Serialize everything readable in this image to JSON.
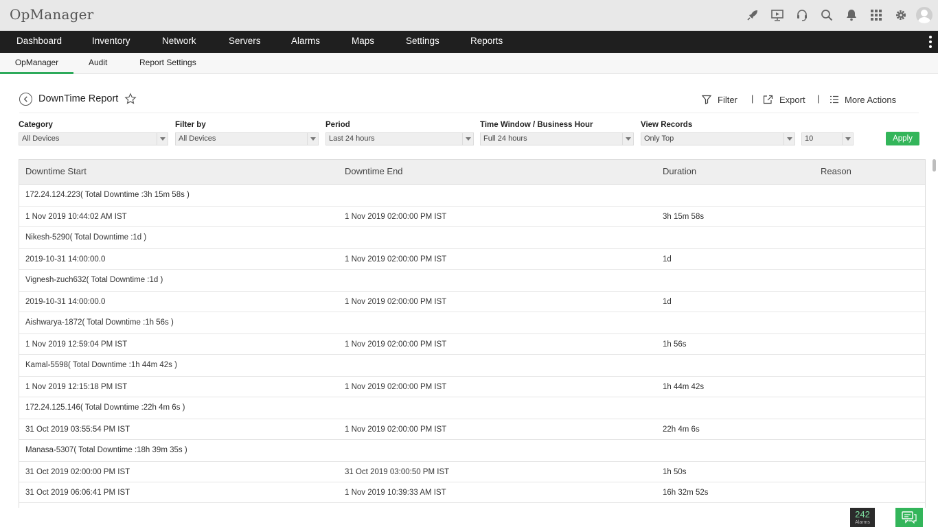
{
  "app": {
    "brand": "OpManager"
  },
  "topbar": {
    "icons": [
      "rocket-icon",
      "presentation-icon",
      "headset-icon",
      "search-icon",
      "bell-icon",
      "apps-grid-icon",
      "gear-icon",
      "user-avatar-icon"
    ]
  },
  "mainnav": {
    "items": [
      "Dashboard",
      "Inventory",
      "Network",
      "Servers",
      "Alarms",
      "Maps",
      "Settings",
      "Reports"
    ]
  },
  "subnav": {
    "items": [
      "OpManager",
      "Audit",
      "Report Settings"
    ],
    "active": "OpManager"
  },
  "report": {
    "title": "DownTime Report",
    "filter_label": "Filter",
    "export_label": "Export",
    "more_label": "More Actions",
    "separator": "|"
  },
  "filters": {
    "category": {
      "label": "Category",
      "value": "All Devices"
    },
    "filter_by": {
      "label": "Filter by",
      "value": "All Devices"
    },
    "period": {
      "label": "Period",
      "value": "Last 24 hours"
    },
    "time_window": {
      "label": "Time Window / Business Hour",
      "value": "Full 24 hours"
    },
    "view_records": {
      "label": "View Records",
      "value": "Only Top"
    },
    "count": {
      "value": "10"
    },
    "apply_label": "Apply"
  },
  "table": {
    "columns": [
      "Downtime Start",
      "Downtime End",
      "Duration",
      "Reason"
    ],
    "rows": [
      {
        "type": "group",
        "text": "172.24.124.223( Total Downtime :3h 15m 58s )"
      },
      {
        "type": "record",
        "start": "1 Nov 2019 10:44:02 AM IST",
        "end": "1 Nov 2019 02:00:00 PM IST",
        "duration": "3h 15m 58s",
        "reason": ""
      },
      {
        "type": "group",
        "text": "Nikesh-5290( Total Downtime :1d )"
      },
      {
        "type": "record",
        "start": "2019-10-31 14:00:00.0",
        "end": "1 Nov 2019 02:00:00 PM IST",
        "duration": "1d",
        "reason": ""
      },
      {
        "type": "group",
        "text": "Vignesh-zuch632( Total Downtime :1d )"
      },
      {
        "type": "record",
        "start": "2019-10-31 14:00:00.0",
        "end": "1 Nov 2019 02:00:00 PM IST",
        "duration": "1d",
        "reason": ""
      },
      {
        "type": "group",
        "text": "Aishwarya-1872( Total Downtime :1h 56s )"
      },
      {
        "type": "record",
        "start": "1 Nov 2019 12:59:04 PM IST",
        "end": "1 Nov 2019 02:00:00 PM IST",
        "duration": "1h 56s",
        "reason": ""
      },
      {
        "type": "group",
        "text": "Kamal-5598( Total Downtime :1h 44m 42s )"
      },
      {
        "type": "record",
        "start": "1 Nov 2019 12:15:18 PM IST",
        "end": "1 Nov 2019 02:00:00 PM IST",
        "duration": "1h 44m 42s",
        "reason": ""
      },
      {
        "type": "group",
        "text": "172.24.125.146( Total Downtime :22h 4m 6s )"
      },
      {
        "type": "record",
        "start": "31 Oct 2019 03:55:54 PM IST",
        "end": "1 Nov 2019 02:00:00 PM IST",
        "duration": "22h 4m 6s",
        "reason": ""
      },
      {
        "type": "group",
        "text": "Manasa-5307( Total Downtime :18h 39m 35s )"
      },
      {
        "type": "record",
        "start": "31 Oct 2019 02:00:00 PM IST",
        "end": "31 Oct 2019 03:00:50 PM IST",
        "duration": "1h 50s",
        "reason": ""
      },
      {
        "type": "record",
        "start": "31 Oct 2019 06:06:41 PM IST",
        "end": "1 Nov 2019 10:39:33 AM IST",
        "duration": "16h 32m 52s",
        "reason": ""
      }
    ]
  },
  "widgets": {
    "alarm_count": "242",
    "alarm_label": "Alarms"
  },
  "colors": {
    "accent": "#33b55a",
    "nav_bg": "#1f1f1f",
    "topbar_bg": "#e8e8e8"
  }
}
